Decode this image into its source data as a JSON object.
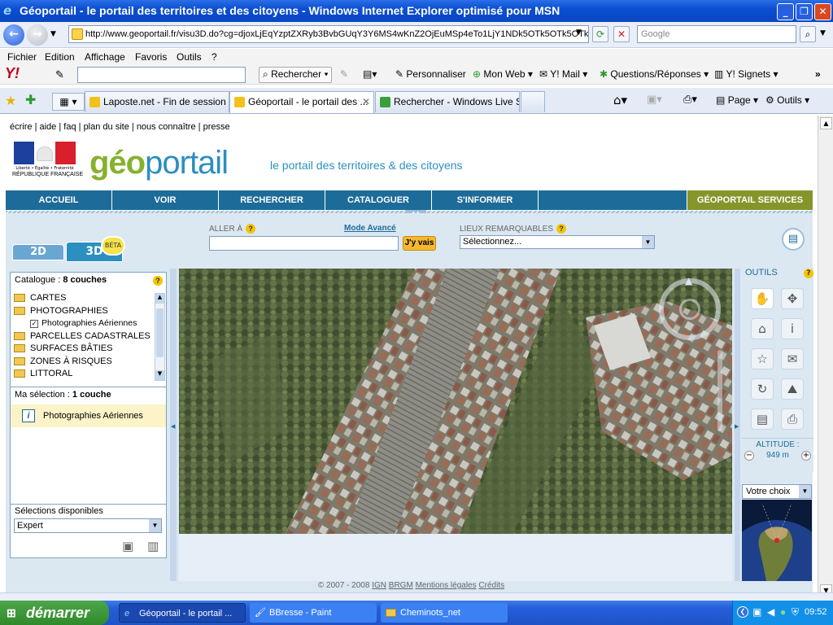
{
  "window": {
    "title": "Géoportail - le portail des territoires et des citoyens - Windows Internet Explorer optimisé pour MSN",
    "minimize": "_",
    "restore": "❐",
    "close": "✕"
  },
  "addressbar": {
    "url": "http://www.geoportail.fr/visu3D.do?cg=djoxLjEqYzptZXRyb3BvbGUqY3Y6MS4wKnZ2OjEuMSp4eTo1LjY1NDk5OTk5OTk5OTk5",
    "search_placeholder": "Google"
  },
  "menu": [
    "Fichier",
    "Edition",
    "Affichage",
    "Favoris",
    "Outils",
    "?"
  ],
  "yahoo_toolbar": {
    "search_button": "Rechercher",
    "items": [
      "Personnaliser",
      "Mon Web",
      "Y! Mail",
      "Questions/Réponses",
      "Y! Signets"
    ]
  },
  "tabs": [
    {
      "label": "Laposte.net - Fin de session",
      "color": "#f2c21a"
    },
    {
      "label": "Géoportail - le portail des ...",
      "color": "#f2c21a"
    },
    {
      "label": "Rechercher - Windows Live S...",
      "color": "#3aa03a"
    }
  ],
  "cmdbar": {
    "page": "Page",
    "tools": "Outils"
  },
  "site": {
    "top_links": [
      "écrire",
      "aide",
      "faq",
      "plan du site",
      "nous connaître",
      "presse"
    ],
    "emblem_text_1": "Liberté • Égalité • Fraternité",
    "emblem_text_2": "RÉPUBLIQUE FRANÇAISE",
    "logo_part1": "géo",
    "logo_part2": "portail",
    "tagline": "le portail des territoires & des citoyens",
    "nav": [
      "ACCUEIL",
      "VOIR",
      "RECHERCHER",
      "CATALOGUER",
      "S'INFORMER",
      "",
      "GÉOPORTAIL SERVICES"
    ]
  },
  "viewer": {
    "tab_2d": "2D",
    "tab_3d": "3D",
    "beta": "BÉTA",
    "goto_label": "ALLER À",
    "advanced_mode": "Mode Avancé",
    "goto_button": "J'y vais",
    "places_label": "LIEUX REMARQUABLES",
    "places_selected": "Sélectionnez..."
  },
  "catalogue": {
    "header_prefix": "Catalogue : ",
    "header_count": "8 couches",
    "items": [
      "CARTES",
      "PHOTOGRAPHIES",
      "Photographies Aériennes",
      "PARCELLES CADASTRALES",
      "SURFACES BÂTIES",
      "ZONES À RISQUES",
      "LITTORAL"
    ],
    "selection_prefix": "Ma sélection : ",
    "selection_count": "1 couche",
    "selection_item": "Photographies Aériennes",
    "available_label": "Sélections disponibles",
    "available_selected": "Expert"
  },
  "tools": {
    "title": "OUTILS",
    "altitude_label": "ALTITUDE :",
    "altitude_value": "949 m",
    "choice_label": "Votre choix"
  },
  "footer": {
    "copyright": "© 2007 - 2008",
    "links": [
      "IGN",
      "BRGM",
      "Mentions légales",
      "Crédits"
    ]
  },
  "taskbar": {
    "start": "démarrer",
    "tasks": [
      "Géoportail - le portail ...",
      "BBresse - Paint",
      "Cheminots_net"
    ],
    "clock": "09:52"
  }
}
